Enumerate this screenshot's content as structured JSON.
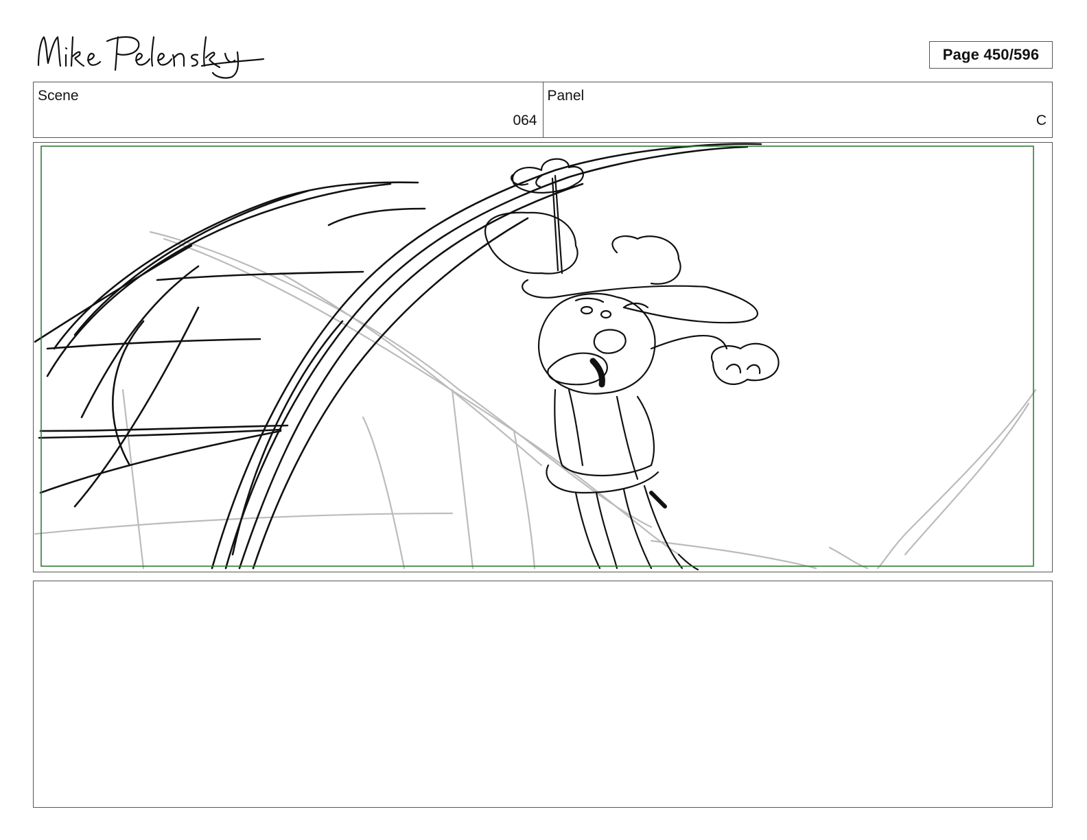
{
  "header": {
    "signature_text": "Mike Pelensky",
    "page_label": "Page 450/596"
  },
  "info": {
    "scene_label": "Scene",
    "scene_value": "064",
    "panel_label": "Panel",
    "panel_value": "C"
  },
  "notes": {
    "text": ""
  },
  "colors": {
    "safe_area_border": "#2e7d32",
    "sketch_line": "#111111",
    "background_sketch": "#bbbbbb"
  }
}
